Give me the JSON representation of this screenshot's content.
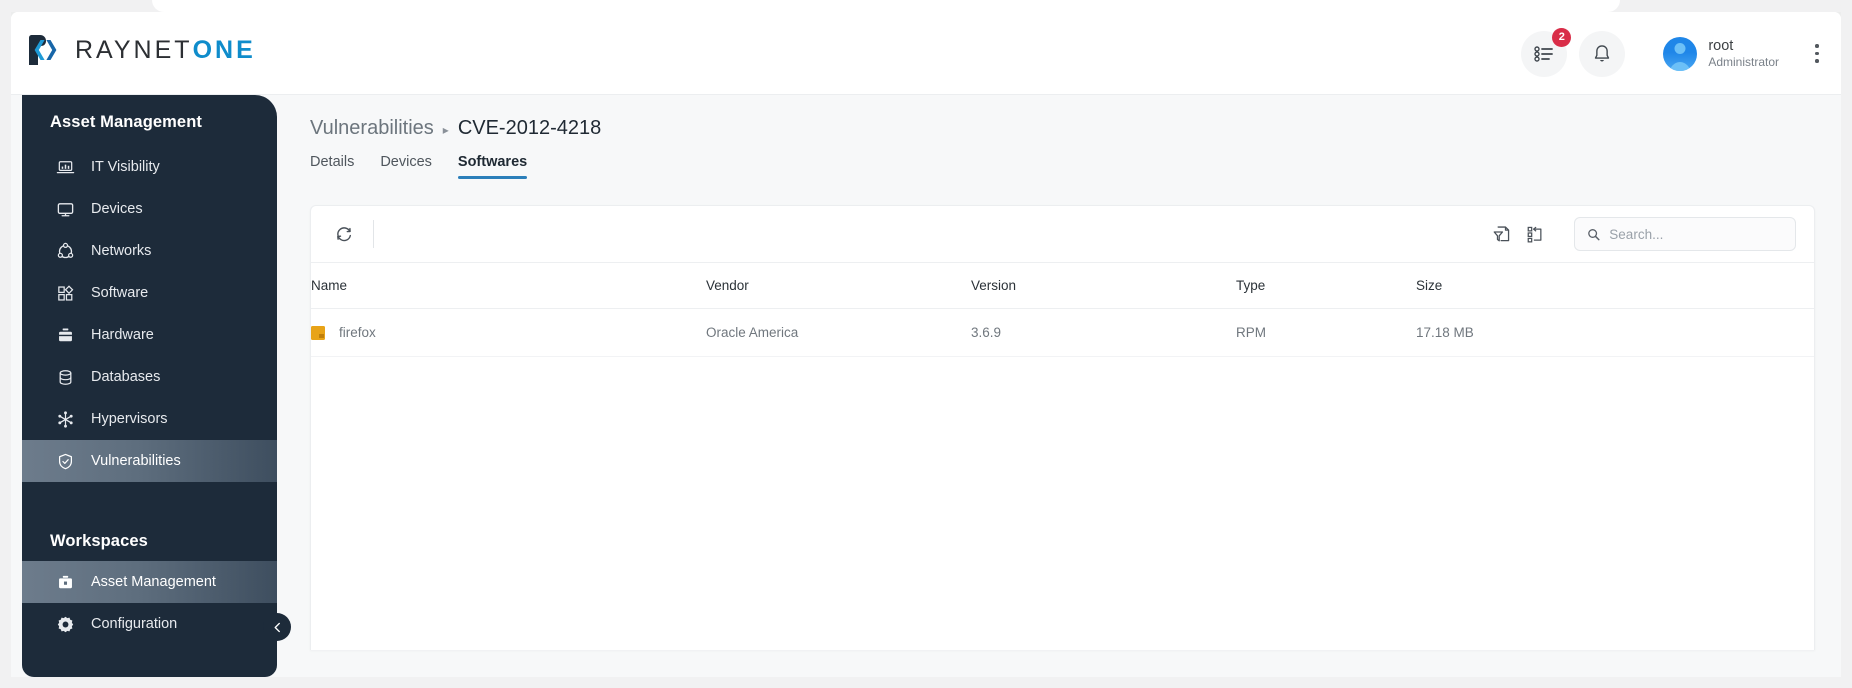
{
  "brand": {
    "name_dark": "RAYNET",
    "name_accent": "ONE",
    "accent_color": "#0f8ccb"
  },
  "topbar": {
    "tasks_icon": "task-list-icon",
    "tasks_badge": "2",
    "badge_color": "#d92d48",
    "notifications_icon": "bell-icon",
    "user": {
      "name": "root",
      "role": "Administrator",
      "avatar_icon": "user-avatar-icon"
    },
    "overflow_icon": "kebab-menu-icon"
  },
  "sidebar": {
    "section_title": "Asset Management",
    "items": [
      {
        "label": "IT Visibility",
        "icon": "laptop-chart-icon",
        "active": false
      },
      {
        "label": "Devices",
        "icon": "monitor-icon",
        "active": false
      },
      {
        "label": "Networks",
        "icon": "network-nodes-icon",
        "active": false
      },
      {
        "label": "Software",
        "icon": "app-blocks-icon",
        "active": false
      },
      {
        "label": "Hardware",
        "icon": "toolbox-icon",
        "active": false
      },
      {
        "label": "Databases",
        "icon": "database-icon",
        "active": false
      },
      {
        "label": "Hypervisors",
        "icon": "hypervisor-nodes-icon",
        "active": false
      },
      {
        "label": "Vulnerabilities",
        "icon": "shield-check-icon",
        "active": true
      }
    ],
    "workspaces_title": "Workspaces",
    "workspaces": [
      {
        "label": "Asset Management",
        "icon": "briefcase-icon",
        "active": true
      },
      {
        "label": "Configuration",
        "icon": "gear-icon",
        "active": false
      }
    ],
    "collapse_icon": "chevron-left-icon",
    "background_color": "#1d2b3a"
  },
  "main": {
    "breadcrumb": {
      "root": "Vulnerabilities",
      "separator": "▸",
      "current": "CVE-2012-4218"
    },
    "tabs": [
      {
        "label": "Details",
        "active": false
      },
      {
        "label": "Devices",
        "active": false
      },
      {
        "label": "Softwares",
        "active": true
      }
    ],
    "tab_accent_color": "#2b7fba",
    "toolbar": {
      "refresh_icon": "refresh-icon",
      "filter_icon": "filter-document-icon",
      "columns_icon": "column-layout-icon",
      "search_icon": "search-icon",
      "search_placeholder": "Search...",
      "search_value": ""
    },
    "table": {
      "columns": [
        "Name",
        "Vendor",
        "Version",
        "Type",
        "Size"
      ],
      "rows": [
        {
          "icon": "package-icon",
          "icon_color": "#e8a317",
          "name": "firefox",
          "vendor": "Oracle America",
          "version": "3.6.9",
          "type": "RPM",
          "size": "17.18 MB"
        }
      ]
    }
  }
}
